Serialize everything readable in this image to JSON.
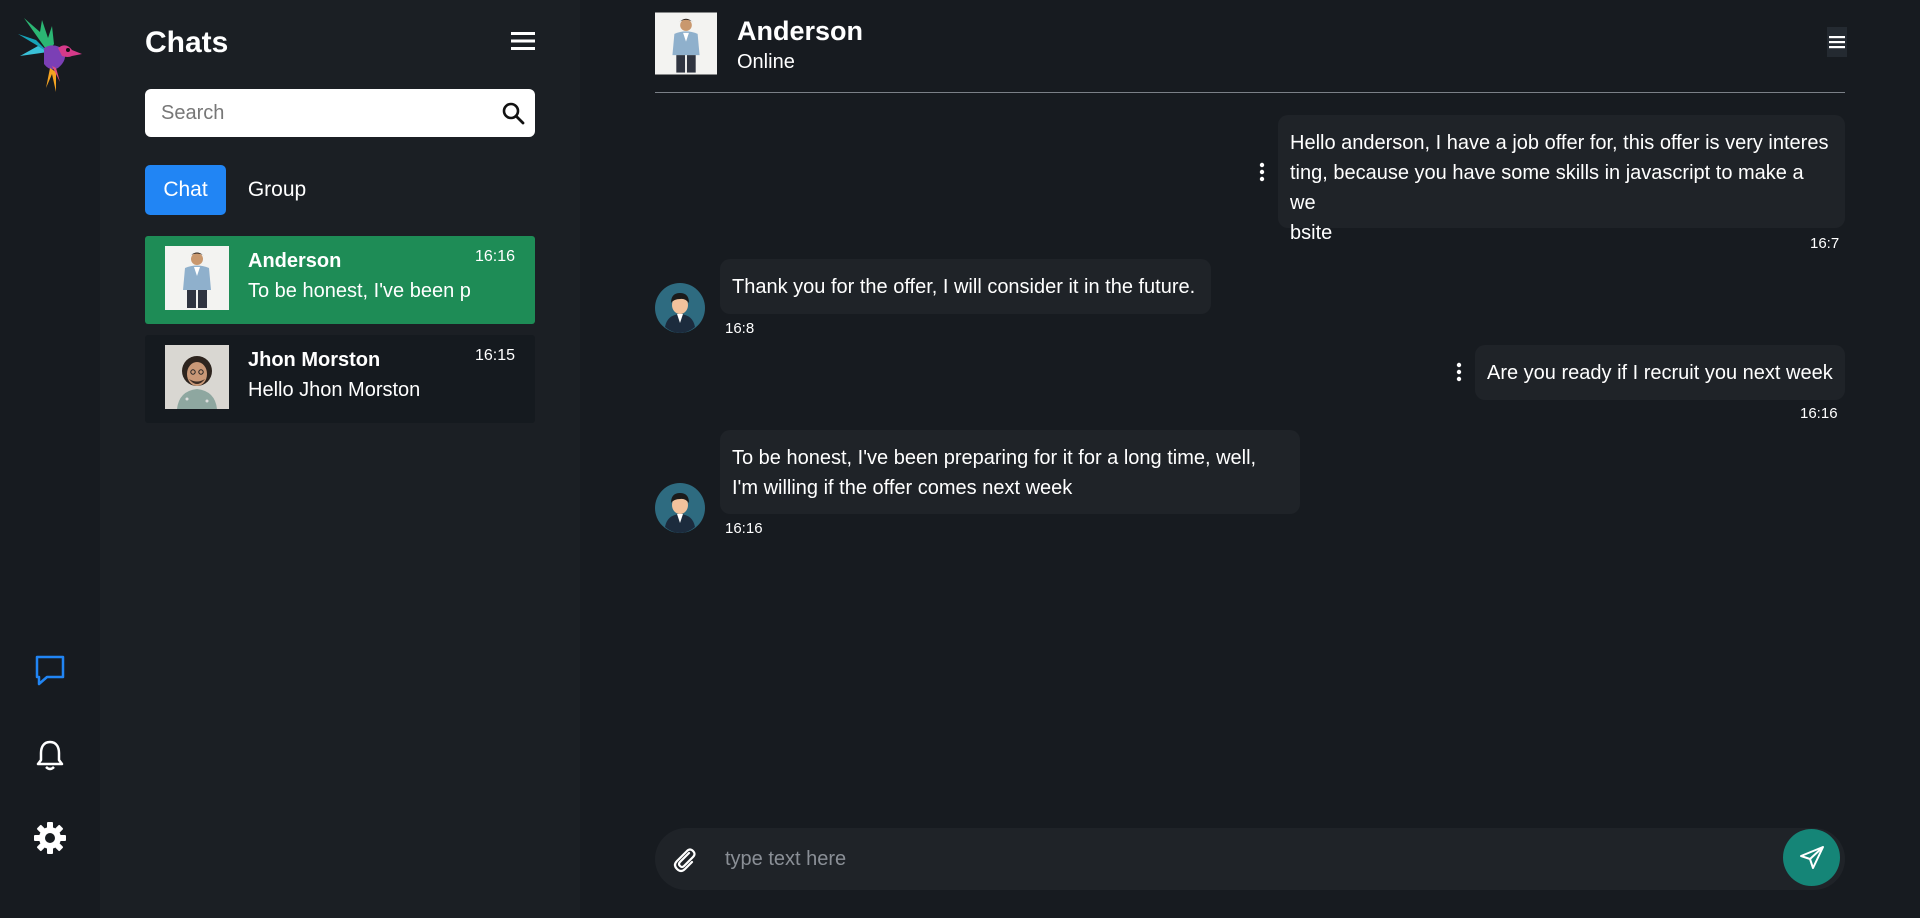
{
  "sidebar": {
    "title": "Chats",
    "search_placeholder": "Search",
    "tabs": [
      {
        "label": "Chat"
      },
      {
        "label": "Group"
      }
    ],
    "chats": [
      {
        "name": "Anderson",
        "preview": "To be honest, I've been p",
        "time": "16:16",
        "active": true
      },
      {
        "name": "Jhon Morston",
        "preview": "Hello Jhon Morston",
        "time": "16:15",
        "active": false
      }
    ]
  },
  "rail": {
    "icons": [
      "chat-icon",
      "bell-icon",
      "gear-icon"
    ],
    "active_color": "#2185f4"
  },
  "conversation": {
    "contact_name": "Anderson",
    "status": "Online",
    "messages": [
      {
        "direction": "outgoing",
        "lines": [
          "Hello anderson, I have a job offer for, this offer is very interes",
          "ting, because you have some skills in javascript to make a we",
          "bsite"
        ],
        "time": "16:7"
      },
      {
        "direction": "incoming",
        "lines": [
          "Thank you for the offer, I will consider it in the future."
        ],
        "time": "16:8"
      },
      {
        "direction": "outgoing",
        "lines": [
          "Are you ready if I recruit you next week"
        ],
        "time": "16:16"
      },
      {
        "direction": "incoming",
        "lines": [
          "To be honest, I've been preparing for it for a long time, well,",
          "I'm willing if the offer comes next week"
        ],
        "time": "16:16"
      }
    ],
    "composer_placeholder": "type text here"
  },
  "colors": {
    "active_chat": "#1e8c56",
    "tab_active": "#2185f4",
    "send_button": "#158577"
  }
}
